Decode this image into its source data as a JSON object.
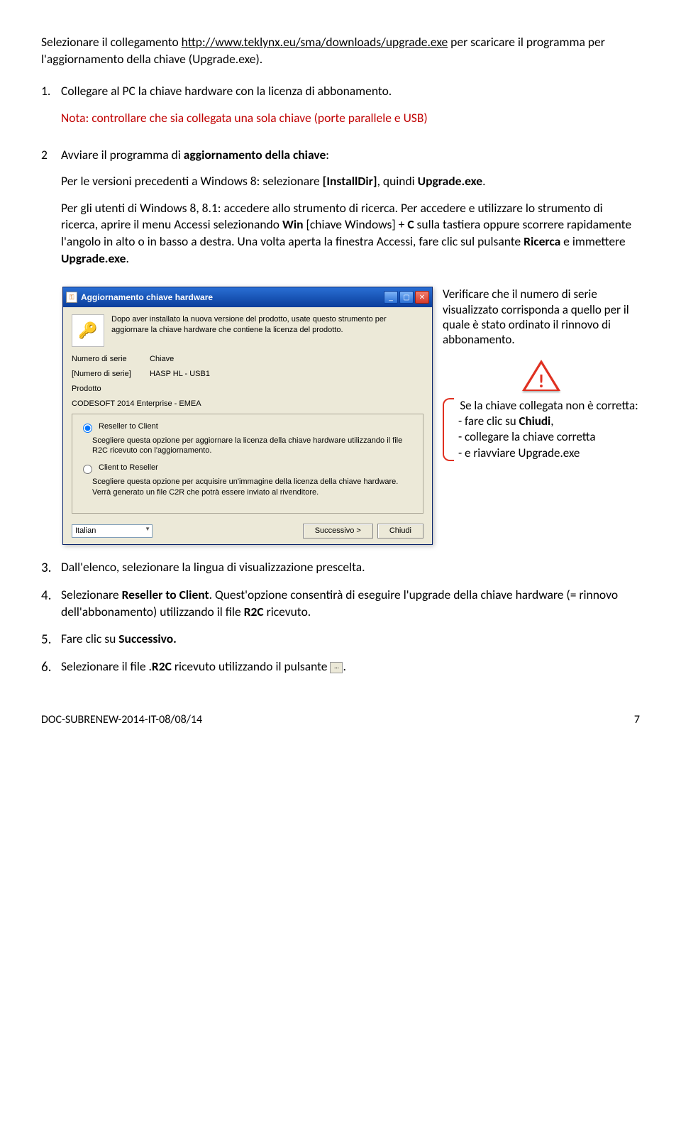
{
  "intro": {
    "pre": "Selezionare il collegamento ",
    "link": "http://www.teklynx.eu/sma/downloads/upgrade.exe",
    "post": " per scaricare il programma per l'aggiornamento della chiave (Upgrade.exe)."
  },
  "step1": {
    "num": "1.",
    "text": "Collegare al PC la chiave hardware con la licenza di abbonamento.",
    "note_label": "Nota",
    "note_text": ": controllare che sia collegata una sola chiave (porte parallele e USB)"
  },
  "step2": {
    "num": "2",
    "lead": "Avviare il programma di ",
    "bold1": "aggiornamento della chiave",
    "tail": ":",
    "p1a": "Per le versioni precedenti a Windows 8: selezionare ",
    "p1b": "[InstallDir]",
    "p1c": ", quindi ",
    "p1d": "Upgrade.exe",
    "p1e": ".",
    "p2a": "Per gli utenti di Windows 8, 8.1: accedere allo strumento di ricerca. Per accedere e utilizzare lo strumento di ricerca, aprire il menu Accessi selezionando ",
    "p2b": "Win",
    "p2c": " [chiave Windows] + ",
    "p2d": "C",
    "p2e": " sulla tastiera oppure scorrere rapidamente l'angolo in alto o in basso a destra. Una volta aperta la finestra Accessi, fare clic sul pulsante ",
    "p2f": "Ricerca",
    "p2g": " e immettere ",
    "p2h": "Upgrade.exe",
    "p2i": "."
  },
  "dialog": {
    "title": "Aggiornamento chiave hardware",
    "desc": "Dopo aver installato la nuova versione del prodotto, usate questo strumento per aggiornare la chiave hardware che contiene la licenza del prodotto.",
    "serial_label": "Numero di serie",
    "serial_value": "[Numero di serie]",
    "key_label": "Chiave",
    "key_value": "HASP HL - USB1",
    "product_label": "Prodotto",
    "product_value": "CODESOFT 2014 Enterprise - EMEA",
    "r1_title": "Reseller to Client",
    "r1_desc": "Scegliere questa opzione per aggiornare la licenza della chiave hardware utilizzando il file R2C ricevuto con l'aggiornamento.",
    "r2_title": "Client to Reseller",
    "r2_desc": "Scegliere questa opzione per acquisire un'immagine della licenza della chiave hardware. Verrà generato un file C2R che potrà essere inviato al rivenditore.",
    "lang": "Italian",
    "btn_next": "Successivo >",
    "btn_close": "Chiudi"
  },
  "side": {
    "verify": "Verificare che il numero di serie visualizzato corrisponda a quello per il quale è stato ordinato il rinnovo di abbonamento.",
    "warn_head": "Se la chiave collegata non è corretta:",
    "a1a": "- fare clic su ",
    "a1b": "Chiudi",
    "a1c": ",",
    "a2": "- collegare la chiave corretta",
    "a3": "- e riavviare Upgrade.exe"
  },
  "step3": {
    "num": "3.",
    "text": "Dall'elenco, selezionare la lingua di visualizzazione prescelta."
  },
  "step4": {
    "num": "4.",
    "a": "Selezionare ",
    "b": "Reseller to Client",
    "c": ". Quest'opzione consentirà di eseguire l'upgrade della chiave hardware (= rinnovo dell'abbonamento) utilizzando il file ",
    "d": "R2C",
    "e": " ricevuto."
  },
  "step5": {
    "num": "5.",
    "a": "Fare clic su ",
    "b": "Successivo."
  },
  "step6": {
    "num": "6.",
    "a": "Selezionare il file .",
    "b": "R2C",
    "c": " ricevuto utilizzando il pulsante ",
    "d": "."
  },
  "footer": {
    "left": "DOC-SUBRENEW-2014-IT-08/08/14",
    "right": "7"
  }
}
